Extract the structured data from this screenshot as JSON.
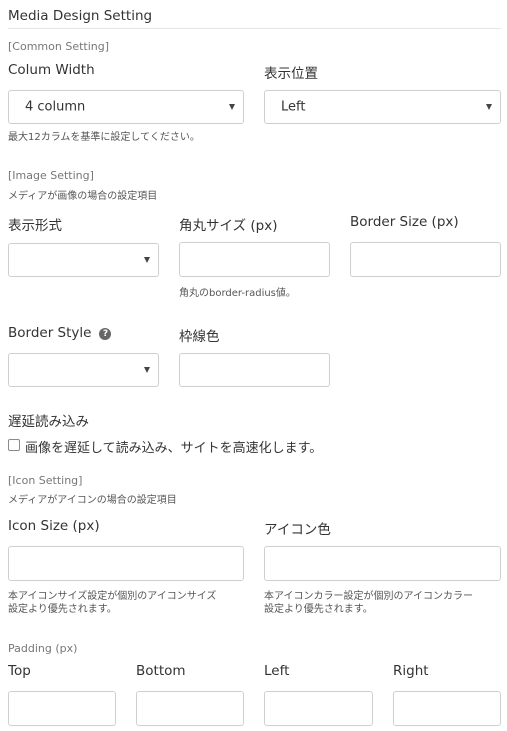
{
  "title": "Media Design Setting",
  "common": {
    "heading": "[Common Setting]",
    "column_width": {
      "label": "Colum Width",
      "value": "4 column"
    },
    "position": {
      "label": "表示位置",
      "value": "Left"
    },
    "note": "最大12カラムを基準に設定してください。"
  },
  "image": {
    "heading": "[Image Setting]",
    "sub": "メディアが画像の場合の設定項目",
    "display_format": {
      "label": "表示形式",
      "value": ""
    },
    "radius": {
      "label": "角丸サイズ (px)",
      "value": "",
      "note": "角丸のborder-radius値。"
    },
    "border_size": {
      "label": "Border Size (px)",
      "value": ""
    },
    "border_style": {
      "label": "Border Style",
      "help_icon": "question-circle-icon",
      "value": ""
    },
    "border_color": {
      "label": "枠線色",
      "value": ""
    },
    "lazy": {
      "label": "遅延読み込み",
      "checkbox_label": "画像を遅延して読み込み、サイトを高速化します。",
      "checked": false
    }
  },
  "icon": {
    "heading": "[Icon Setting]",
    "sub": "メディアがアイコンの場合の設定項目",
    "size": {
      "label": "Icon Size (px)",
      "value": "",
      "note_line1": "本アイコンサイズ設定が個別のアイコンサイズ",
      "note_line2": "設定より優先されます。"
    },
    "color": {
      "label": "アイコン色",
      "value": "",
      "note_line1": "本アイコンカラー設定が個別のアイコンカラー",
      "note_line2": "設定より優先されます。"
    }
  },
  "padding": {
    "heading": "Padding (px)",
    "top": {
      "label": "Top",
      "value": ""
    },
    "bottom": {
      "label": "Bottom",
      "value": ""
    },
    "left": {
      "label": "Left",
      "value": ""
    },
    "right": {
      "label": "Right",
      "value": ""
    }
  }
}
